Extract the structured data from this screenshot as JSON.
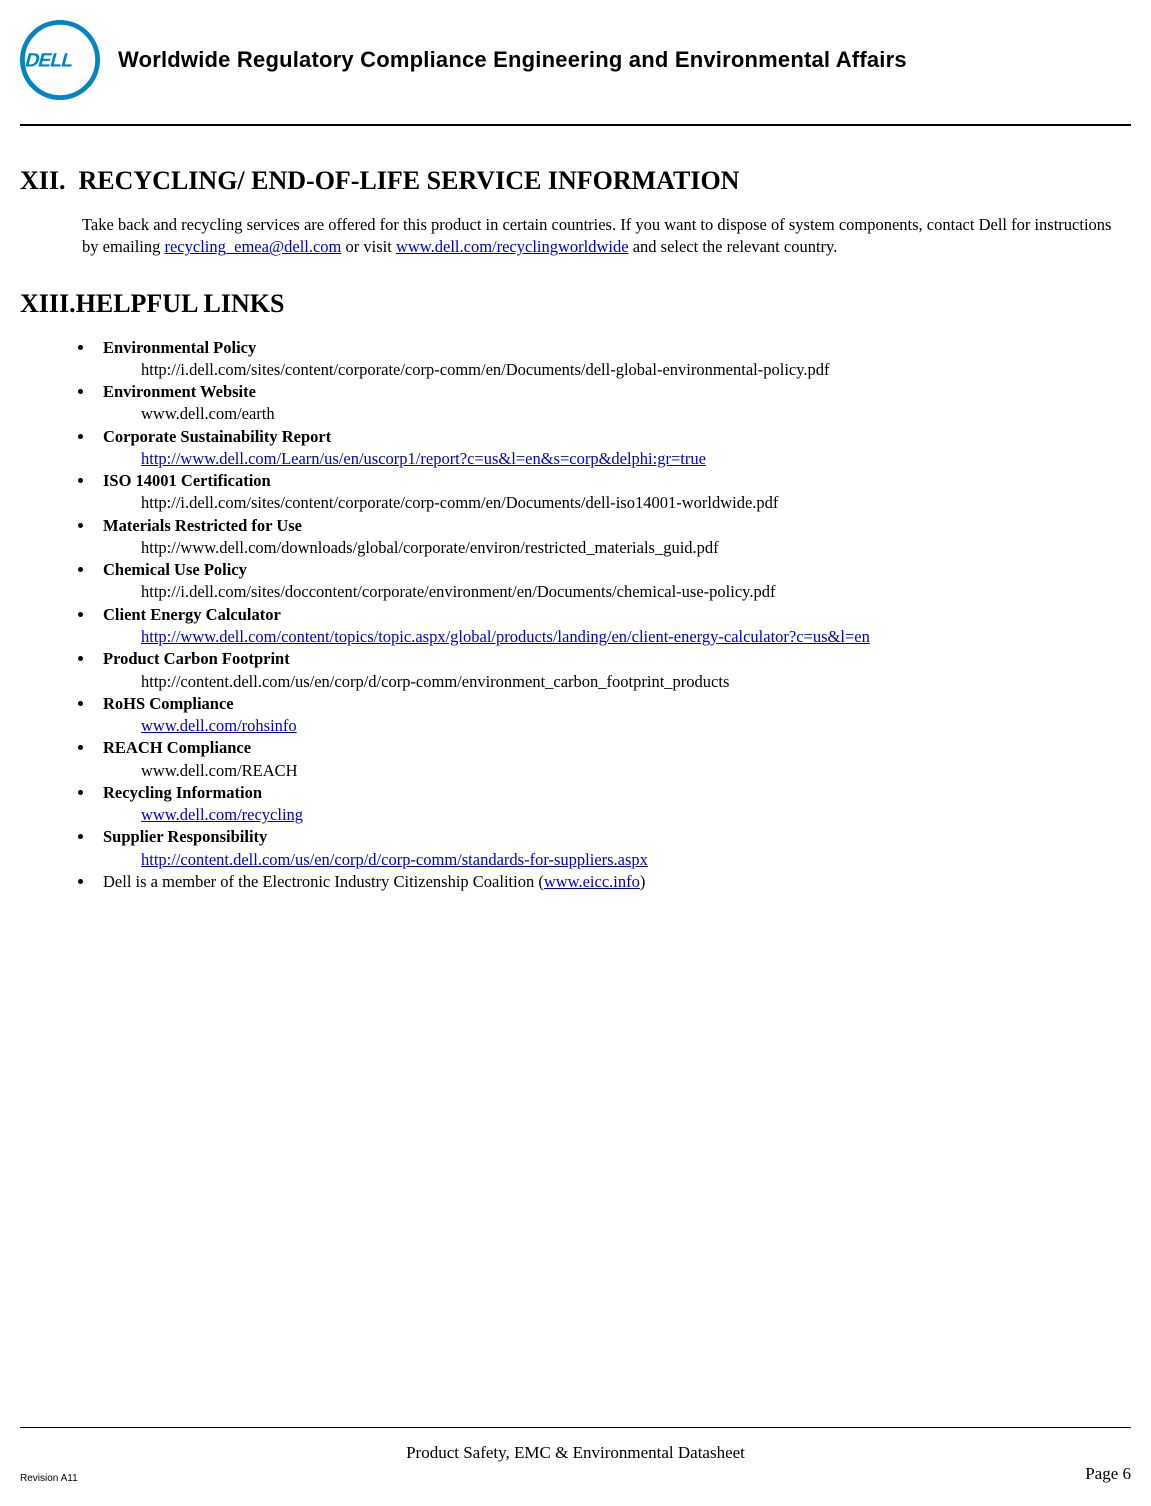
{
  "header": {
    "title": "Worldwide Regulatory Compliance Engineering and Environmental Affairs"
  },
  "section12": {
    "number": "XII.",
    "title": "RECYCLING/ END-OF-LIFE SERVICE INFORMATION",
    "para_pre": "Take back and recycling services are offered for this product in certain countries. If you want to dispose of system components, contact Dell for instructions by emailing ",
    "email": "recycling_emea@dell.com",
    "para_mid": " or visit ",
    "url": "www.dell.com/recyclingworldwide",
    "para_post": " and select the relevant country."
  },
  "section13": {
    "number": "XIII.",
    "title": "HELPFUL LINKS",
    "items": [
      {
        "label": "Environmental Policy",
        "url": "http://i.dell.com/sites/content/corporate/corp-comm/en/Documents/dell-global-environmental-policy.pdf",
        "is_link": false
      },
      {
        "label": "Environment Website",
        "url": "www.dell.com/earth",
        "is_link": false
      },
      {
        "label": "Corporate Sustainability Report",
        "url": "http://www.dell.com/Learn/us/en/uscorp1/report?c=us&l=en&s=corp&delphi:gr=true",
        "is_link": true
      },
      {
        "label": "ISO 14001 Certification",
        "url": "http://i.dell.com/sites/content/corporate/corp-comm/en/Documents/dell-iso14001-worldwide.pdf",
        "is_link": false
      },
      {
        "label": "Materials Restricted for Use",
        "url": "http://www.dell.com/downloads/global/corporate/environ/restricted_materials_guid.pdf",
        "is_link": false
      },
      {
        "label": "Chemical Use Policy",
        "url": "http://i.dell.com/sites/doccontent/corporate/environment/en/Documents/chemical-use-policy.pdf",
        "is_link": false
      },
      {
        "label": "Client Energy Calculator",
        "url": "http://www.dell.com/content/topics/topic.aspx/global/products/landing/en/client-energy-calculator?c=us&l=en",
        "is_link": true
      },
      {
        "label": "Product Carbon Footprint",
        "url": "http://content.dell.com/us/en/corp/d/corp-comm/environment_carbon_footprint_products",
        "is_link": false
      },
      {
        "label": "RoHS Compliance",
        "url": "www.dell.com/rohsinfo",
        "is_link": true
      },
      {
        "label": "REACH Compliance",
        "url": "www.dell.com/REACH",
        "is_link": false
      },
      {
        "label": "Recycling Information",
        "url": "www.dell.com/recycling",
        "is_link": true
      },
      {
        "label": "Supplier Responsibility",
        "url": "http://content.dell.com/us/en/corp/d/corp-comm/standards-for-suppliers.aspx",
        "is_link": true
      }
    ],
    "final_pre": "Dell is a member of the Electronic Industry Citizenship Coalition (",
    "final_link": "www.eicc.info",
    "final_post": ")"
  },
  "footer": {
    "center": "Product Safety, EMC & Environmental Datasheet",
    "revision": "Revision A11",
    "page": "Page 6"
  }
}
